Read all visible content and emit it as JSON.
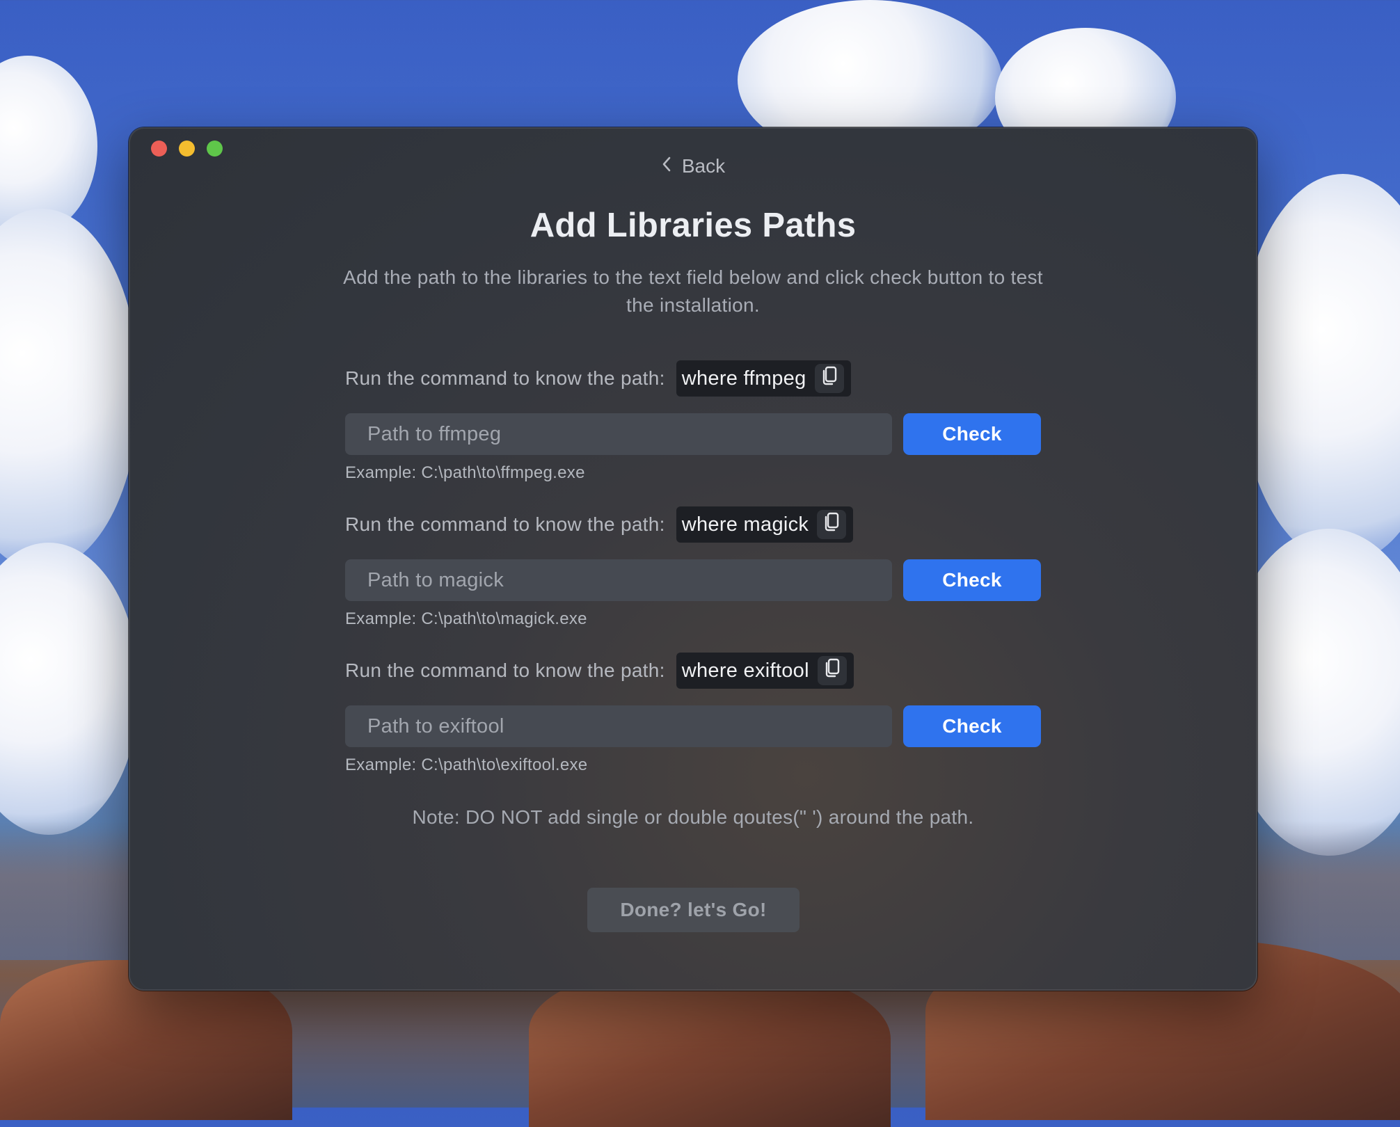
{
  "window": {
    "traffic_lights": {
      "close_color": "#ec5f57",
      "minimize_color": "#f4bd2f",
      "zoom_color": "#5fc64a"
    }
  },
  "nav": {
    "back_label": "Back",
    "back_icon": "chevron-left-icon"
  },
  "header": {
    "title": "Add Libraries Paths",
    "subtitle": "Add the path to the libraries to the text field below and click check button to test the installation."
  },
  "libraries": [
    {
      "command_prompt": "Run the command to know the path:",
      "command": "where ffmpeg",
      "copy_icon": "copy-icon",
      "input_value": "",
      "input_placeholder": "Path to ffmpeg",
      "check_label": "Check",
      "example": "Example: C:\\path\\to\\ffmpeg.exe"
    },
    {
      "command_prompt": "Run the command to know the path:",
      "command": "where magick",
      "copy_icon": "copy-icon",
      "input_value": "",
      "input_placeholder": "Path to magick",
      "check_label": "Check",
      "example": "Example: C:\\path\\to\\magick.exe"
    },
    {
      "command_prompt": "Run the command to know the path:",
      "command": "where exiftool",
      "copy_icon": "copy-icon",
      "input_value": "",
      "input_placeholder": "Path to exiftool",
      "check_label": "Check",
      "example": "Example: C:\\path\\to\\exiftool.exe"
    }
  ],
  "footer": {
    "note": "Note: DO NOT add single or double qoutes(\" ') around the path.",
    "done_label": "Done? let's Go!"
  },
  "colors": {
    "accent": "#2f73ee",
    "window_bg": "#32363d",
    "input_bg": "#464a52",
    "chip_bg": "#1d1f24"
  }
}
